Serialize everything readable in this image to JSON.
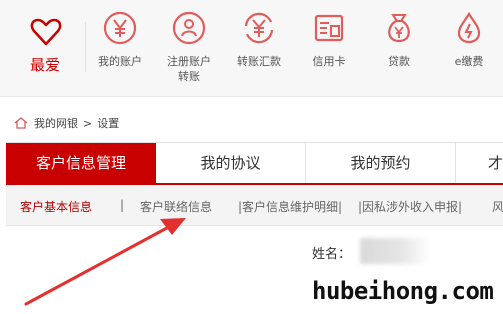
{
  "quick_nav": {
    "favorite_label": "最爱",
    "items": [
      {
        "label": "我的账户",
        "icon": "yen-circle-icon"
      },
      {
        "label": "注册账户转账",
        "icon": "register-transfer-icon"
      },
      {
        "label": "转账汇款",
        "icon": "yen-transfer-icon"
      },
      {
        "label": "信用卡",
        "icon": "credit-card-icon"
      },
      {
        "label": "贷款",
        "icon": "money-bag-icon"
      },
      {
        "label": "e缴费",
        "icon": "droplet-icon"
      }
    ]
  },
  "breadcrumb": {
    "home": "我的网银",
    "separator": ">",
    "current": "设置"
  },
  "tabs": [
    {
      "label": "客户信息管理",
      "active": true
    },
    {
      "label": "我的协议",
      "active": false
    },
    {
      "label": "我的预约",
      "active": false
    },
    {
      "label": "才",
      "active": false
    }
  ],
  "subnav": {
    "items": [
      "客户基本信息",
      "|",
      "客户联络信息",
      "|客户信息维护明细|",
      "|因私涉外收入申报|",
      "风"
    ]
  },
  "form": {
    "name_label": "姓名："
  },
  "watermark": "hubeihong.com",
  "colors": {
    "accent": "#c80000",
    "icon": "#e25c5c",
    "arrow": "#e53030"
  }
}
